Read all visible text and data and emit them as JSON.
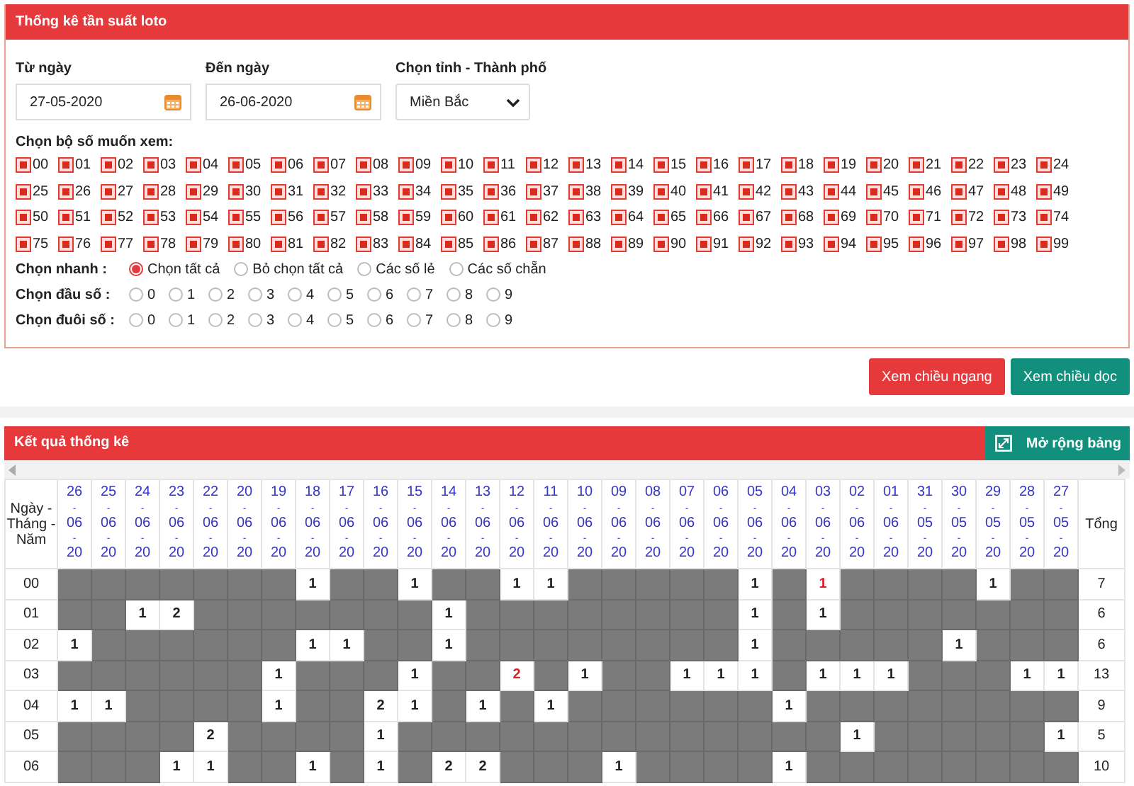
{
  "filter_panel": {
    "title": "Thống kê tần suất loto",
    "from_date": {
      "label": "Từ ngày",
      "value": "27-05-2020"
    },
    "to_date": {
      "label": "Đến ngày",
      "value": "26-06-2020"
    },
    "province": {
      "label": "Chọn tỉnh - Thành phố",
      "value": "Miền Bắc"
    },
    "numbers_label": "Chọn bộ số muốn xem:",
    "numbers": [
      {
        "label": "00",
        "checked": true
      },
      {
        "label": "01",
        "checked": true
      },
      {
        "label": "02",
        "checked": true
      },
      {
        "label": "03",
        "checked": true
      },
      {
        "label": "04",
        "checked": true
      },
      {
        "label": "05",
        "checked": true
      },
      {
        "label": "06",
        "checked": true
      },
      {
        "label": "07",
        "checked": true
      },
      {
        "label": "08",
        "checked": true
      },
      {
        "label": "09",
        "checked": true
      },
      {
        "label": "10",
        "checked": true
      },
      {
        "label": "11",
        "checked": true
      },
      {
        "label": "12",
        "checked": true
      },
      {
        "label": "13",
        "checked": true
      },
      {
        "label": "14",
        "checked": true
      },
      {
        "label": "15",
        "checked": true
      },
      {
        "label": "16",
        "checked": true
      },
      {
        "label": "17",
        "checked": true
      },
      {
        "label": "18",
        "checked": true
      },
      {
        "label": "19",
        "checked": true
      },
      {
        "label": "20",
        "checked": true
      },
      {
        "label": "21",
        "checked": true
      },
      {
        "label": "22",
        "checked": true
      },
      {
        "label": "23",
        "checked": true
      },
      {
        "label": "24",
        "checked": true
      },
      {
        "label": "25",
        "checked": true
      },
      {
        "label": "26",
        "checked": true
      },
      {
        "label": "27",
        "checked": true
      },
      {
        "label": "28",
        "checked": true
      },
      {
        "label": "29",
        "checked": true
      },
      {
        "label": "30",
        "checked": true
      },
      {
        "label": "31",
        "checked": true
      },
      {
        "label": "32",
        "checked": true
      },
      {
        "label": "33",
        "checked": true
      },
      {
        "label": "34",
        "checked": true
      },
      {
        "label": "35",
        "checked": true
      },
      {
        "label": "36",
        "checked": true
      },
      {
        "label": "37",
        "checked": true
      },
      {
        "label": "38",
        "checked": true
      },
      {
        "label": "39",
        "checked": true
      },
      {
        "label": "40",
        "checked": true
      },
      {
        "label": "41",
        "checked": true
      },
      {
        "label": "42",
        "checked": true
      },
      {
        "label": "43",
        "checked": true
      },
      {
        "label": "44",
        "checked": true
      },
      {
        "label": "45",
        "checked": true
      },
      {
        "label": "46",
        "checked": true
      },
      {
        "label": "47",
        "checked": true
      },
      {
        "label": "48",
        "checked": true
      },
      {
        "label": "49",
        "checked": true
      },
      {
        "label": "50",
        "checked": true
      },
      {
        "label": "51",
        "checked": true
      },
      {
        "label": "52",
        "checked": true
      },
      {
        "label": "53",
        "checked": true
      },
      {
        "label": "54",
        "checked": true
      },
      {
        "label": "55",
        "checked": true
      },
      {
        "label": "56",
        "checked": true
      },
      {
        "label": "57",
        "checked": true
      },
      {
        "label": "58",
        "checked": true
      },
      {
        "label": "59",
        "checked": true
      },
      {
        "label": "60",
        "checked": true
      },
      {
        "label": "61",
        "checked": true
      },
      {
        "label": "62",
        "checked": true
      },
      {
        "label": "63",
        "checked": true
      },
      {
        "label": "64",
        "checked": true
      },
      {
        "label": "65",
        "checked": true
      },
      {
        "label": "66",
        "checked": true
      },
      {
        "label": "67",
        "checked": true
      },
      {
        "label": "68",
        "checked": true
      },
      {
        "label": "69",
        "checked": true
      },
      {
        "label": "70",
        "checked": true
      },
      {
        "label": "71",
        "checked": true
      },
      {
        "label": "72",
        "checked": true
      },
      {
        "label": "73",
        "checked": true
      },
      {
        "label": "74",
        "checked": true
      },
      {
        "label": "75",
        "checked": true
      },
      {
        "label": "76",
        "checked": true
      },
      {
        "label": "77",
        "checked": true
      },
      {
        "label": "78",
        "checked": true
      },
      {
        "label": "79",
        "checked": true
      },
      {
        "label": "80",
        "checked": true
      },
      {
        "label": "81",
        "checked": true
      },
      {
        "label": "82",
        "checked": true
      },
      {
        "label": "83",
        "checked": true
      },
      {
        "label": "84",
        "checked": true
      },
      {
        "label": "85",
        "checked": true
      },
      {
        "label": "86",
        "checked": true
      },
      {
        "label": "87",
        "checked": true
      },
      {
        "label": "88",
        "checked": true
      },
      {
        "label": "89",
        "checked": true
      },
      {
        "label": "90",
        "checked": true
      },
      {
        "label": "91",
        "checked": true
      },
      {
        "label": "92",
        "checked": true
      },
      {
        "label": "93",
        "checked": true
      },
      {
        "label": "94",
        "checked": true
      },
      {
        "label": "95",
        "checked": true
      },
      {
        "label": "96",
        "checked": true
      },
      {
        "label": "97",
        "checked": true
      },
      {
        "label": "98",
        "checked": true
      },
      {
        "label": "99",
        "checked": true
      }
    ],
    "radio_groups": [
      {
        "label": "Chọn nhanh :",
        "kind": "wide",
        "options": [
          {
            "label": "Chọn tất cả",
            "selected": true
          },
          {
            "label": "Bỏ chọn tất cả",
            "selected": false
          },
          {
            "label": "Các số lẻ",
            "selected": false
          },
          {
            "label": "Các số chẵn",
            "selected": false
          }
        ]
      },
      {
        "label": "Chọn đầu số :",
        "kind": "digit",
        "options": [
          {
            "label": "0",
            "selected": false
          },
          {
            "label": "1",
            "selected": false
          },
          {
            "label": "2",
            "selected": false
          },
          {
            "label": "3",
            "selected": false
          },
          {
            "label": "4",
            "selected": false
          },
          {
            "label": "5",
            "selected": false
          },
          {
            "label": "6",
            "selected": false
          },
          {
            "label": "7",
            "selected": false
          },
          {
            "label": "8",
            "selected": false
          },
          {
            "label": "9",
            "selected": false
          }
        ]
      },
      {
        "label": "Chọn đuôi số :",
        "kind": "digit",
        "options": [
          {
            "label": "0",
            "selected": false
          },
          {
            "label": "1",
            "selected": false
          },
          {
            "label": "2",
            "selected": false
          },
          {
            "label": "3",
            "selected": false
          },
          {
            "label": "4",
            "selected": false
          },
          {
            "label": "5",
            "selected": false
          },
          {
            "label": "6",
            "selected": false
          },
          {
            "label": "7",
            "selected": false
          },
          {
            "label": "8",
            "selected": false
          },
          {
            "label": "9",
            "selected": false
          }
        ]
      }
    ]
  },
  "buttons": [
    {
      "label": "Xem chiều ngang",
      "kind": "danger"
    },
    {
      "label": "Xem chiều dọc",
      "kind": "success"
    }
  ],
  "results": {
    "title": "Kết quả thống kê",
    "expand_button": "Mở rộng bảng",
    "corner_header": "Ngày - Tháng - Năm",
    "total_header": "Tổng",
    "dates": [
      "26-06-20",
      "25-06-20",
      "24-06-20",
      "23-06-20",
      "22-06-20",
      "20-06-20",
      "19-06-20",
      "18-06-20",
      "17-06-20",
      "16-06-20",
      "15-06-20",
      "14-06-20",
      "13-06-20",
      "12-06-20",
      "11-06-20",
      "10-06-20",
      "09-06-20",
      "08-06-20",
      "07-06-20",
      "06-06-20",
      "05-06-20",
      "04-06-20",
      "03-06-20",
      "02-06-20",
      "01-06-20",
      "31-05-20",
      "30-05-20",
      "29-05-20",
      "28-05-20",
      "27-05-20"
    ],
    "rows": [
      {
        "number": "00",
        "total": "7",
        "cells": [
          null,
          null,
          null,
          null,
          null,
          null,
          null,
          {
            "value": "1",
            "highlighted": false
          },
          null,
          null,
          {
            "value": "1",
            "highlighted": false
          },
          null,
          null,
          {
            "value": "1",
            "highlighted": false
          },
          {
            "value": "1",
            "highlighted": false
          },
          null,
          null,
          null,
          null,
          null,
          {
            "value": "1",
            "highlighted": false
          },
          null,
          {
            "value": "1",
            "highlighted": true
          },
          null,
          null,
          null,
          null,
          {
            "value": "1",
            "highlighted": false
          },
          null,
          null
        ]
      },
      {
        "number": "01",
        "total": "6",
        "cells": [
          null,
          null,
          {
            "value": "1",
            "highlighted": false
          },
          {
            "value": "2",
            "highlighted": false
          },
          null,
          null,
          null,
          null,
          null,
          null,
          null,
          {
            "value": "1",
            "highlighted": false
          },
          null,
          null,
          null,
          null,
          null,
          null,
          null,
          null,
          {
            "value": "1",
            "highlighted": false
          },
          null,
          {
            "value": "1",
            "highlighted": false
          },
          null,
          null,
          null,
          null,
          null,
          null,
          null
        ]
      },
      {
        "number": "02",
        "total": "6",
        "cells": [
          {
            "value": "1",
            "highlighted": false
          },
          null,
          null,
          null,
          null,
          null,
          null,
          {
            "value": "1",
            "highlighted": false
          },
          {
            "value": "1",
            "highlighted": false
          },
          null,
          null,
          {
            "value": "1",
            "highlighted": false
          },
          null,
          null,
          null,
          null,
          null,
          null,
          null,
          null,
          {
            "value": "1",
            "highlighted": false
          },
          null,
          null,
          null,
          null,
          null,
          {
            "value": "1",
            "highlighted": false
          },
          null,
          null,
          null
        ]
      },
      {
        "number": "03",
        "total": "13",
        "cells": [
          null,
          null,
          null,
          null,
          null,
          null,
          {
            "value": "1",
            "highlighted": false
          },
          null,
          null,
          null,
          {
            "value": "1",
            "highlighted": false
          },
          null,
          null,
          {
            "value": "2",
            "highlighted": true
          },
          null,
          {
            "value": "1",
            "highlighted": false
          },
          null,
          null,
          {
            "value": "1",
            "highlighted": false
          },
          {
            "value": "1",
            "highlighted": false
          },
          {
            "value": "1",
            "highlighted": false
          },
          null,
          {
            "value": "1",
            "highlighted": false
          },
          {
            "value": "1",
            "highlighted": false
          },
          {
            "value": "1",
            "highlighted": false
          },
          null,
          null,
          null,
          {
            "value": "1",
            "highlighted": false
          },
          {
            "value": "1",
            "highlighted": false
          }
        ]
      },
      {
        "number": "04",
        "total": "9",
        "cells": [
          {
            "value": "1",
            "highlighted": false
          },
          {
            "value": "1",
            "highlighted": false
          },
          null,
          null,
          null,
          null,
          {
            "value": "1",
            "highlighted": false
          },
          null,
          null,
          {
            "value": "2",
            "highlighted": false
          },
          {
            "value": "1",
            "highlighted": false
          },
          null,
          {
            "value": "1",
            "highlighted": false
          },
          null,
          {
            "value": "1",
            "highlighted": false
          },
          null,
          null,
          null,
          null,
          null,
          null,
          {
            "value": "1",
            "highlighted": false
          },
          null,
          null,
          null,
          null,
          null,
          null,
          null,
          null
        ]
      },
      {
        "number": "05",
        "total": "5",
        "cells": [
          null,
          null,
          null,
          null,
          {
            "value": "2",
            "highlighted": false
          },
          null,
          null,
          null,
          null,
          {
            "value": "1",
            "highlighted": false
          },
          null,
          null,
          null,
          null,
          null,
          null,
          null,
          null,
          null,
          null,
          null,
          null,
          null,
          {
            "value": "1",
            "highlighted": false
          },
          null,
          null,
          null,
          null,
          null,
          {
            "value": "1",
            "highlighted": false
          }
        ]
      },
      {
        "number": "06",
        "total": "10",
        "cells": [
          null,
          null,
          null,
          {
            "value": "1",
            "highlighted": false
          },
          {
            "value": "1",
            "highlighted": false
          },
          null,
          null,
          {
            "value": "1",
            "highlighted": false
          },
          null,
          {
            "value": "1",
            "highlighted": false
          },
          null,
          {
            "value": "2",
            "highlighted": false
          },
          {
            "value": "2",
            "highlighted": false
          },
          null,
          null,
          null,
          {
            "value": "1",
            "highlighted": false
          },
          null,
          null,
          null,
          null,
          {
            "value": "1",
            "highlighted": false
          },
          null,
          null,
          null,
          null,
          null,
          null,
          null,
          null
        ]
      }
    ]
  }
}
